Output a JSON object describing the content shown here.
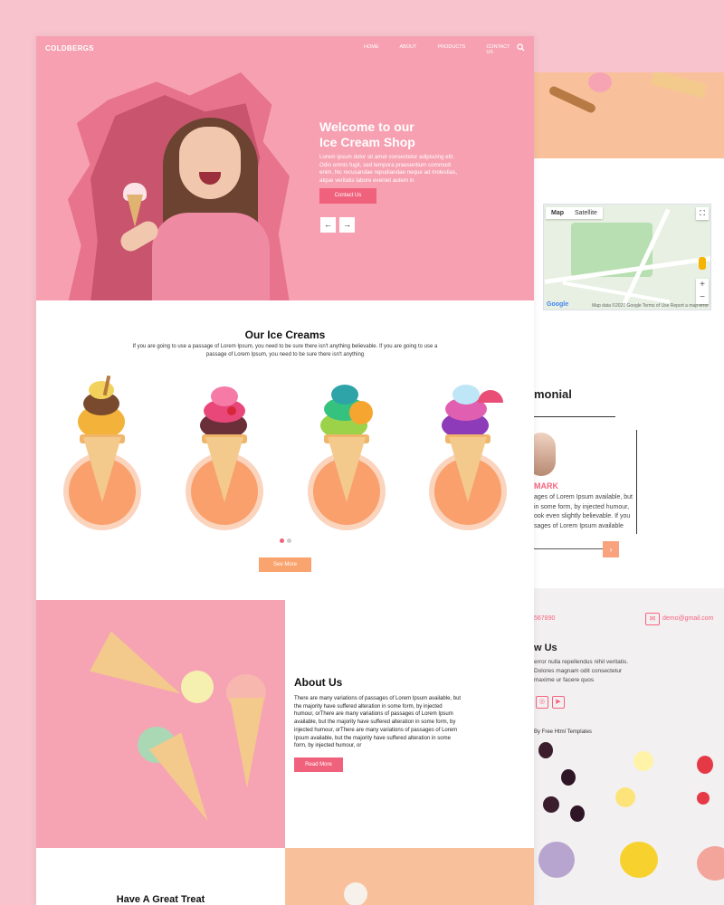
{
  "main": {
    "brand": "COLDBERGS",
    "nav": [
      "HOME",
      "ABOUT",
      "PRODUCTS",
      "CONTACT US"
    ],
    "hero": {
      "title_line1": "Welcome to our",
      "title_line2": "Ice Cream Shop",
      "text": "Lorem ipsum dolor sit amet consectetur adipiscing elit. Odio omnis fugit, sed tempora praesentium commodi enim, hic recusandae repudiandae neque ad molestias, atque veritatis labore eveniet autem in",
      "button": "Contact Us",
      "prev": "←",
      "next": "→"
    },
    "ice_creams": {
      "title": "Our Ice Creams",
      "subtitle": "If you are going to use a passage of Lorem Ipsum, you need to be sure there isn't anything believable. If you are going to use a passage of Lorem Ipsum, you need to be sure there isn't anything",
      "button": "See More"
    },
    "about": {
      "title": "About Us",
      "text": "There are many variations of passages of Lorem Ipsum available, but the majority have suffered alteration in some form, by injected humour, orThere are many variations of passages of Lorem Ipsum available, but the majority have suffered alteration in some form, by injected humour, orThere are many variations of passages of Lorem Ipsum available, but the majority have suffered alteration in some form, by injected humour, or",
      "button": "Read More"
    },
    "treat": {
      "title": "Have A Great Treat"
    }
  },
  "back": {
    "map": {
      "tab_map": "Map",
      "tab_satellite": "Satellite",
      "zoom_in": "+",
      "zoom_out": "−",
      "logo": "Google",
      "attribution": "Map data ©2020 Google   Terms of Use   Report a map error"
    },
    "testimonial": {
      "title": "monial",
      "name": "MARK",
      "text": "ages of Lorem Ipsum available, but in some form, by injected humour, ook even slightly believable. If you sages of Lorem Ipsum available",
      "next": "›"
    },
    "contact": {
      "phone": "567890",
      "email": "demo@gmail.com"
    },
    "follow": {
      "title": "w Us",
      "text": "error nulla repellendus nihil veritatis. Dolores magnam odit consectetur maxime ur facere quos",
      "credit": "By Free Html Templates"
    }
  },
  "colors": {
    "page_bg": "#f8c3cd",
    "hero_pink": "#f6a0b1",
    "accent_pink": "#f0617c",
    "accent_orange": "#f9a36e",
    "peach": "#f9c19b"
  }
}
